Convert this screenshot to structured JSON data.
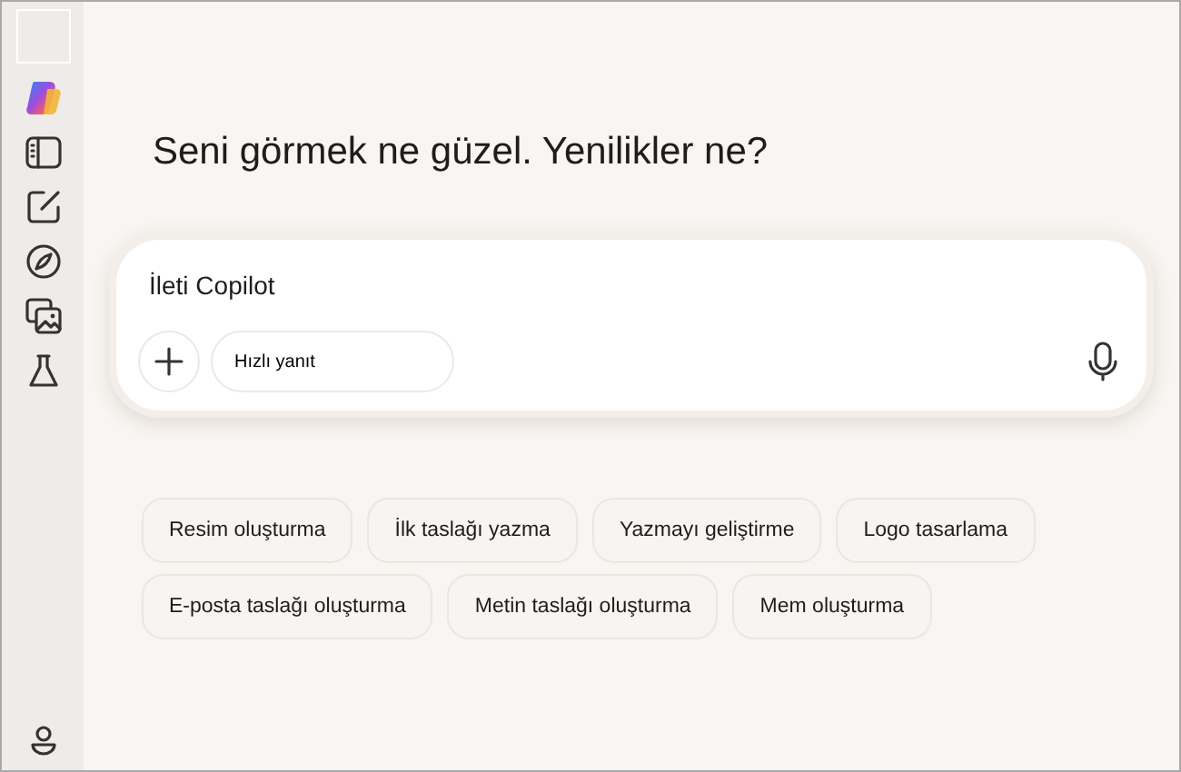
{
  "sidebar": {
    "items": [
      {
        "kind": "blank"
      },
      {
        "kind": "logo"
      },
      {
        "kind": "panel"
      },
      {
        "kind": "edit"
      },
      {
        "kind": "compass"
      },
      {
        "kind": "images"
      },
      {
        "kind": "flask"
      }
    ],
    "footer": {
      "kind": "user"
    }
  },
  "heading": "Seni görmek ne güzel. Yenilikler ne?",
  "composer": {
    "placeholder": "İleti Copilot",
    "mode_button": "Hızlı yanıt"
  },
  "suggestions": [
    "Resim oluşturma",
    "İlk taslağı yazma",
    "Yazmayı geliştirme",
    "Logo tasarlama",
    "E-posta taslağı oluşturma",
    "Metin taslağı oluşturma",
    "Mem oluşturma"
  ]
}
